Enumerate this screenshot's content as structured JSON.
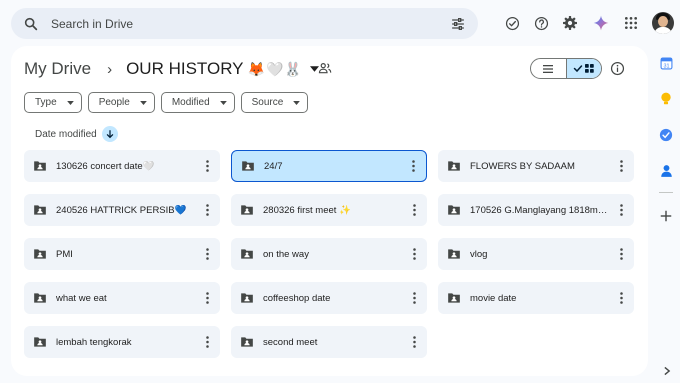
{
  "search": {
    "placeholder": "Search in Drive"
  },
  "top_icons": [
    "offline-status-icon",
    "help-icon",
    "settings-icon",
    "gemini-icon",
    "apps-grid-icon"
  ],
  "breadcrumb": {
    "root": "My Drive",
    "separator": "›",
    "current": "OUR HISTORY",
    "current_emoji": "🦊🤍🐰"
  },
  "view": {
    "list_label": "List layout",
    "grid_label": "Grid layout",
    "active": "grid"
  },
  "filters": [
    {
      "label": "Type"
    },
    {
      "label": "People"
    },
    {
      "label": "Modified"
    },
    {
      "label": "Source"
    }
  ],
  "sort": {
    "label": "Date modified",
    "direction": "descending"
  },
  "folders": [
    {
      "name": "130626 concert date🤍",
      "selected": false
    },
    {
      "name": "24/7",
      "selected": true
    },
    {
      "name": "FLOWERS BY SADAAM",
      "selected": false
    },
    {
      "name": "240526 HATTRICK PERSIB💙",
      "selected": false
    },
    {
      "name": "280326 first meet ✨",
      "selected": false
    },
    {
      "name": "170526 G.Manglayang 1818md…",
      "selected": false
    },
    {
      "name": "PMI",
      "selected": false
    },
    {
      "name": "on the way",
      "selected": false
    },
    {
      "name": "vlog",
      "selected": false
    },
    {
      "name": "what we eat",
      "selected": false
    },
    {
      "name": "coffeeshop date",
      "selected": false
    },
    {
      "name": "movie date",
      "selected": false
    },
    {
      "name": "lembah tengkorak",
      "selected": false
    },
    {
      "name": "second meet",
      "selected": false
    }
  ],
  "side_panel": [
    "calendar-icon",
    "keep-icon",
    "tasks-icon",
    "contacts-icon",
    "add-icon"
  ],
  "colors": {
    "accent": "#0b57d0",
    "selected_bg": "#c2e7ff",
    "card_bg": "#f0f4f9",
    "page_bg": "#f8fafd"
  }
}
